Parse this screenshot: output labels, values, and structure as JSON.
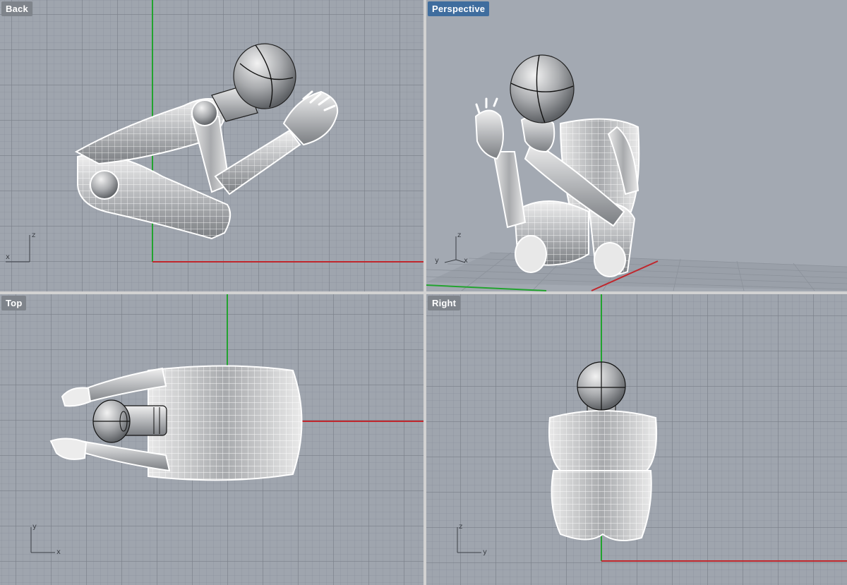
{
  "viewports": {
    "back": {
      "title": "Back",
      "axis_h": "x",
      "axis_v": "z",
      "active": false
    },
    "persp": {
      "title": "Perspective",
      "axis_h": "x",
      "axis_v": "z",
      "axis_d": "y",
      "active": true
    },
    "top": {
      "title": "Top",
      "axis_h": "x",
      "axis_v": "y",
      "active": false
    },
    "right": {
      "title": "Right",
      "axis_h": "y",
      "axis_v": "z",
      "active": false
    }
  },
  "colors": {
    "viewport_bg": "#9fa5ae",
    "active_title_bg": "#3f6d9e",
    "title_bg": "#7f848b",
    "axis_x": "#c0272d",
    "axis_y": "#22a32f",
    "wireframe": "#ffffff",
    "model_shade": "#b9bcc0"
  },
  "model": {
    "name_icon": "robot-figure-wireframe"
  }
}
